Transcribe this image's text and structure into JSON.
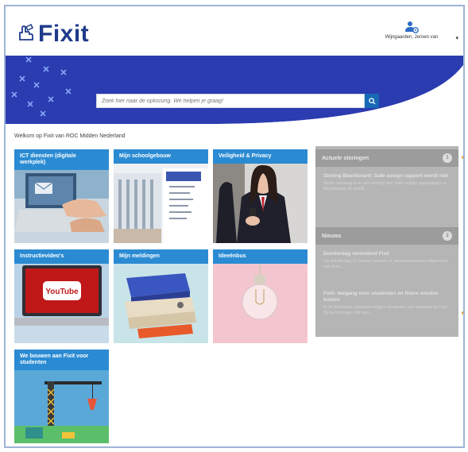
{
  "brand": {
    "name": "Fixit",
    "color": "#1e3a8a",
    "accent": "#2a8bd3"
  },
  "user": {
    "name": "Wijngaarden, Jeroen van"
  },
  "search": {
    "placeholder": "Zoek hier naar de oplossing. We helpen je graag!"
  },
  "welcome": "Welkom op Fixit van ROC Midden Nederland",
  "tiles": [
    {
      "label": "ICT diensten (digitale werkplek)"
    },
    {
      "label": "Mijn schoolgebouw"
    },
    {
      "label": "Veiligheid & Privacy"
    },
    {
      "label": "Instructievideo's"
    },
    {
      "label": "Mijn meldingen"
    },
    {
      "label": "Ideeënbus"
    },
    {
      "label": "We bouwen aan Fixit voor studenten"
    }
  ],
  "sidebar": {
    "storingen": {
      "title": "Actuele storingen",
      "count": "1",
      "items": [
        {
          "title": "Storing Blackboard: Safe assign rapport wordt niet",
          "desc": "Sinds vandaag is er een storing met Safe assign rapportages in Blackboard. Er wordt..."
        }
      ]
    },
    "nieuws": {
      "title": "Nieuws",
      "count": "2",
      "items": [
        {
          "title": "Donderdag veronderd Fixit",
          "desc": "Op donderdag 17 januari worden er werkzaamheden uitgevoerd aan Fixit..."
        },
        {
          "title": "Fixit: toegang voor studenten en fixers worden komen",
          "desc": "In de komende maanden krijgen studenten ook toegang tot Fixit. Zij kunnen dan ook hun..."
        }
      ]
    }
  },
  "youtube_text": "YouTube"
}
